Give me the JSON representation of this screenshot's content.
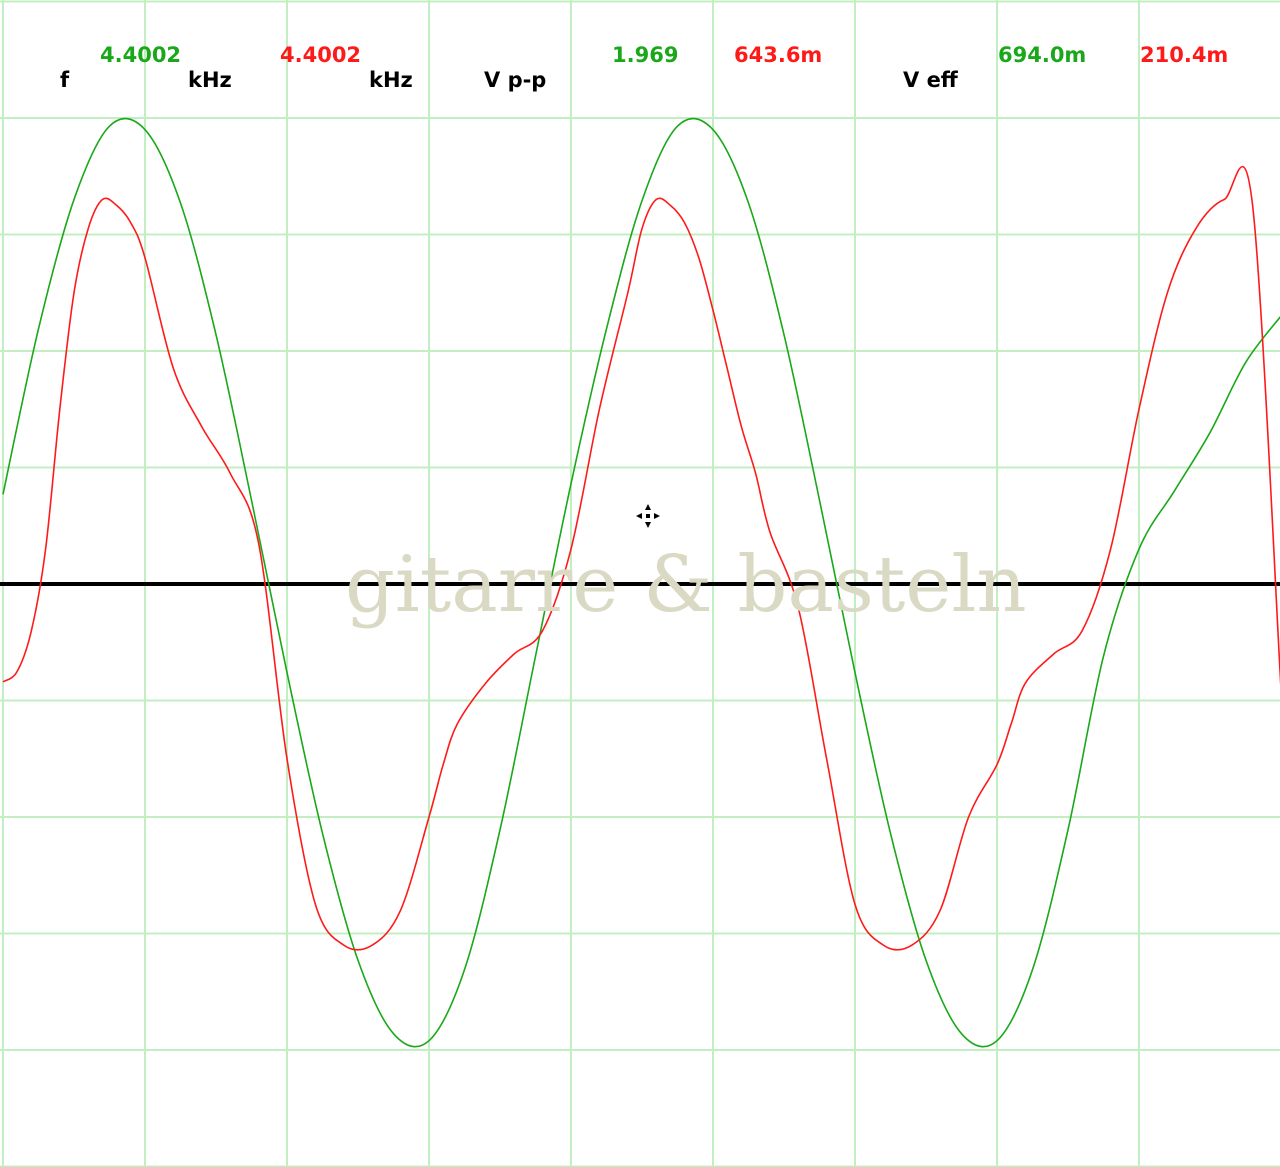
{
  "readout": {
    "f_label": "f",
    "freq_ch1": "4.4002",
    "freq_ch1_unit": "kHz",
    "freq_ch2": "4.4002",
    "freq_ch2_unit": "kHz",
    "vpp_label": "V p-p",
    "vpp_ch1": "1.969",
    "vpp_ch2": "643.6m",
    "veff_label": "V eff",
    "veff_ch1": "694.0m",
    "veff_ch2": "210.4m"
  },
  "watermark": "gitarre & basteln",
  "colors": {
    "ch1": "#1aa81a",
    "ch2": "#ff1a1a",
    "grid": "#c2efc2",
    "baseline": "#000000",
    "label": "#000000"
  },
  "chart_data": {
    "type": "line",
    "grid": true,
    "x_divisions": 9,
    "y_divisions": 10,
    "xlim": [
      0,
      9
    ],
    "ylim": [
      -5,
      5
    ],
    "series": [
      {
        "channel": "ch1",
        "x": [
          0,
          0.25,
          0.5,
          0.75,
          1.0,
          1.25,
          1.5,
          1.75,
          2.0,
          2.25,
          2.5,
          2.75,
          3.0,
          3.25,
          3.5,
          3.75,
          4.0,
          4.25,
          4.5,
          4.75,
          5.0,
          5.25,
          5.5,
          5.75,
          6.0,
          6.25,
          6.5,
          6.75,
          7.0,
          7.25,
          7.5,
          7.75,
          8.0,
          8.25,
          8.5,
          8.75,
          9.0
        ],
        "values": [
          0.77,
          2.19,
          3.3,
          3.93,
          3.9,
          3.27,
          2.14,
          0.72,
          -0.76,
          -2.14,
          -3.23,
          -3.86,
          -3.92,
          -3.31,
          -2.11,
          -0.62,
          0.86,
          2.19,
          3.29,
          3.93,
          3.9,
          3.27,
          2.14,
          0.72,
          -0.76,
          -2.14,
          -3.23,
          -3.86,
          -3.92,
          -3.31,
          -2.11,
          -0.62,
          0.3,
          0.8,
          1.3,
          1.9,
          2.3
        ]
      },
      {
        "channel": "ch2",
        "x": [
          0,
          0.1,
          0.2,
          0.3,
          0.4,
          0.5,
          0.6,
          0.7,
          0.8,
          0.9,
          1.0,
          1.2,
          1.4,
          1.6,
          1.8,
          2.0,
          2.2,
          2.4,
          2.6,
          2.8,
          3.0,
          3.1,
          3.2,
          3.4,
          3.6,
          3.8,
          4.0,
          4.2,
          4.4,
          4.5,
          4.6,
          4.7,
          4.8,
          4.9,
          5.0,
          5.1,
          5.2,
          5.3,
          5.4,
          5.6,
          5.8,
          6.0,
          6.2,
          6.4,
          6.6,
          6.8,
          7.0,
          7.1,
          7.2,
          7.4,
          7.6,
          7.8,
          8.0,
          8.2,
          8.4,
          8.6,
          8.8,
          9.0
        ],
        "values": [
          -0.84,
          -0.75,
          -0.4,
          0.3,
          1.5,
          2.5,
          3.05,
          3.3,
          3.25,
          3.1,
          2.8,
          1.85,
          1.35,
          0.95,
          0.35,
          -1.5,
          -2.75,
          -3.1,
          -3.1,
          -2.8,
          -2.0,
          -1.55,
          -1.2,
          -0.85,
          -0.6,
          -0.4,
          0.3,
          1.5,
          2.5,
          3.05,
          3.3,
          3.25,
          3.1,
          2.8,
          2.35,
          1.85,
          1.35,
          0.95,
          0.45,
          -0.2,
          -1.5,
          -2.75,
          -3.1,
          -3.1,
          -2.8,
          -2.0,
          -1.55,
          -1.2,
          -0.85,
          -0.6,
          -0.4,
          0.3,
          1.5,
          2.5,
          3.05,
          3.3,
          3.25,
          -0.9
        ]
      }
    ]
  }
}
